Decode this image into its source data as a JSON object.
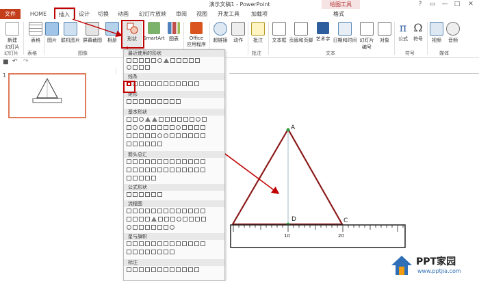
{
  "window": {
    "title": "演示文稿1 - PowerPoint",
    "context_group": "绘图工具",
    "controls": [
      "?",
      "▭",
      "—",
      "□",
      "✕"
    ]
  },
  "tabs": [
    {
      "label": "文件",
      "kind": "file"
    },
    {
      "label": "HOME"
    },
    {
      "label": "插入",
      "active": true
    },
    {
      "label": "设计"
    },
    {
      "label": "切换"
    },
    {
      "label": "动画"
    },
    {
      "label": "幻灯片放映"
    },
    {
      "label": "审阅"
    },
    {
      "label": "视图"
    },
    {
      "label": "开发工具"
    },
    {
      "label": "加载项"
    },
    {
      "label": "格式"
    }
  ],
  "ribbon": {
    "buttons": [
      {
        "label": "新建\n幻灯片",
        "icon": "new-slide-icon"
      },
      {
        "label": "表格",
        "icon": "table-icon"
      },
      {
        "label": "图片",
        "icon": "picture-icon"
      },
      {
        "label": "联机图片",
        "icon": "online-picture-icon"
      },
      {
        "label": "屏幕截图",
        "icon": "screenshot-icon"
      },
      {
        "label": "相册",
        "icon": "album-icon"
      },
      {
        "label": "形状",
        "icon": "shapes-icon"
      },
      {
        "label": "SmartArt",
        "icon": "smartart-icon"
      },
      {
        "label": "图表",
        "icon": "chart-icon"
      },
      {
        "label": "Office\n应用程序",
        "icon": "office-apps-icon"
      },
      {
        "label": "超链接",
        "icon": "hyperlink-icon"
      },
      {
        "label": "动作",
        "icon": "action-icon"
      },
      {
        "label": "批注",
        "icon": "comment-icon"
      },
      {
        "label": "文本框",
        "icon": "textbox-icon"
      },
      {
        "label": "页眉和页脚",
        "icon": "header-footer-icon"
      },
      {
        "label": "艺术字",
        "icon": "wordart-icon"
      },
      {
        "label": "日期和时间",
        "icon": "datetime-icon"
      },
      {
        "label": "幻灯片\n编号",
        "icon": "slide-number-icon"
      },
      {
        "label": "对象",
        "icon": "object-icon"
      },
      {
        "label": "公式",
        "icon": "equation-icon"
      },
      {
        "label": "符号",
        "icon": "symbol-icon"
      },
      {
        "label": "视频",
        "icon": "video-icon"
      },
      {
        "label": "音频",
        "icon": "audio-icon"
      }
    ],
    "groups": [
      "幻灯片",
      "表格",
      "图像",
      "批注",
      "文本",
      "符号",
      "媒体"
    ]
  },
  "dropdown": {
    "sections": [
      "最近使用的形状",
      "线条",
      "矩形",
      "基本形状",
      "箭头总汇",
      "公式形状",
      "流程图",
      "星与旗帜",
      "标注"
    ]
  },
  "slide": {
    "number": "1"
  },
  "diagram": {
    "labels": {
      "apex": "A",
      "foot": "D",
      "right": "C"
    },
    "ruler_labels": [
      "10",
      "20"
    ]
  },
  "watermark": {
    "brand": "PPT家园",
    "url": "www.pptjia.com"
  },
  "colors": {
    "accent": "#c43e1c",
    "highlight": "#c00000",
    "triangle": "#8b1a1a",
    "arrow": "#c00000",
    "point": "#2e9e3e"
  }
}
